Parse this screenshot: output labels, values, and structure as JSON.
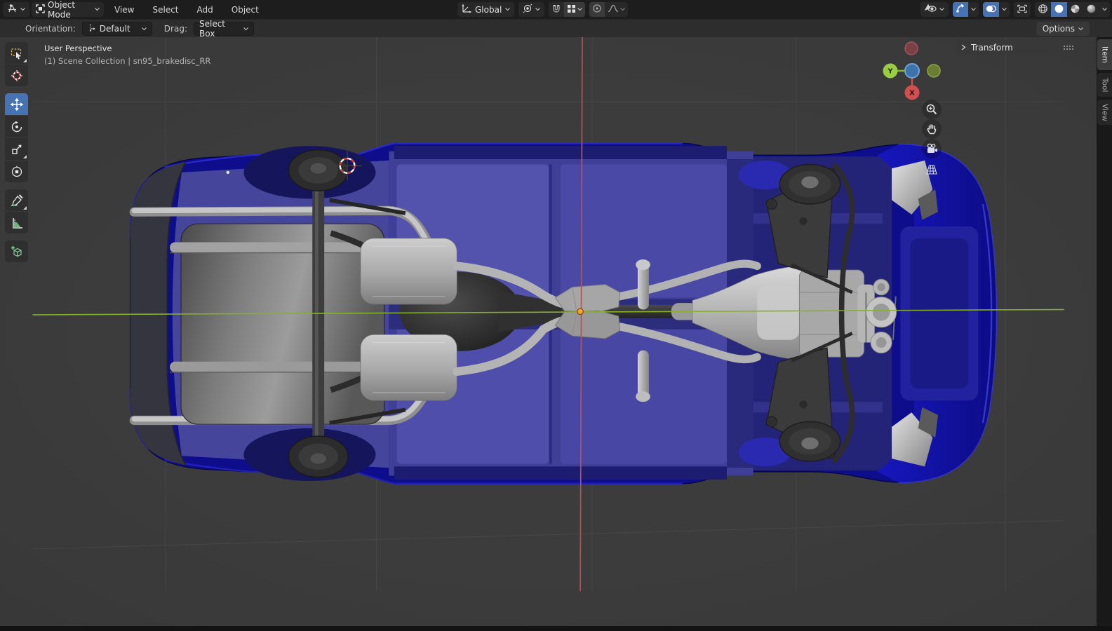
{
  "colors": {
    "header_bg": "#1d1d1d",
    "toolbar_bg": "#2d2d2d",
    "widget_bg": "#282828",
    "accent": "#4772b3",
    "text": "#dddddd",
    "viewport_bg": "#3b3b3b",
    "grid_line": "#474747",
    "axis_x_red": "#bd4f55",
    "axis_y_green": "#86b12b",
    "origin_orange": "#ff9e2c",
    "gizmo_x": "#d24f4f",
    "gizmo_y": "#9acc45",
    "gizmo_z": "#3d72ab",
    "gizmo_neg_x": "#7a4046",
    "gizmo_neg_y": "#6b7c33",
    "car_body_blue": "#0e0e8d",
    "car_body_bright": "#1919c6",
    "car_floor_blue": "#4d4da8",
    "car_recess_blue": "#23236e",
    "metal_light": "#bfbfbf",
    "metal_mid": "#8d8d8d",
    "chassis_dark": "#2b2b2b"
  },
  "topbar": {
    "editor_type_icon": "3d-viewport-editor-icon",
    "mode": {
      "label": "Object Mode",
      "icon": "object-mode-icon"
    },
    "menus": [
      "View",
      "Select",
      "Add",
      "Object"
    ],
    "transform_orientation": {
      "label": "Global",
      "icon": "orientation-axes-icon"
    },
    "pivot_icon": "pivot-point-icon",
    "snap_icons": [
      "magnet-icon",
      "snap-increment-icon"
    ],
    "proportional_icons": [
      "proportional-circle-icon",
      "falloff-curve-icon"
    ],
    "right_toggles": [
      "show-object-types",
      "gizmos",
      "overlays",
      "toggle-xray"
    ],
    "shading_modes": [
      "wireframe",
      "solid",
      "material-preview",
      "rendered"
    ],
    "shading_active": "solid"
  },
  "tool_settings": {
    "orientation_label": "Orientation:",
    "orientation_value": "Default",
    "drag_label": "Drag:",
    "drag_value": "Select Box",
    "options_label": "Options"
  },
  "left_toolbar": {
    "active_tool": "move",
    "tools": [
      "select-box",
      "cursor",
      "move",
      "rotate",
      "scale",
      "transform",
      "annotate",
      "measure",
      "add-cube"
    ]
  },
  "viewport": {
    "view_label": "User Perspective",
    "collection_path": "(1) Scene Collection | sn95_brakedisc_RR",
    "transform_panel": "Transform",
    "sidebar_tabs": [
      "Item",
      "Tool",
      "View"
    ],
    "active_tab": "Item",
    "axis_gizmo": {
      "x_label": "X",
      "y_label": "Y"
    },
    "nav_icons": [
      "zoom-icon",
      "pan-hand-icon",
      "camera-view-icon",
      "perspective-grid-icon"
    ],
    "scene_description": "Bottom view of a blue sports-car chassis: fuel tank, rear axle with differential, dual exhaust with mufflers, driveshaft, transmission, engine and front suspension"
  }
}
